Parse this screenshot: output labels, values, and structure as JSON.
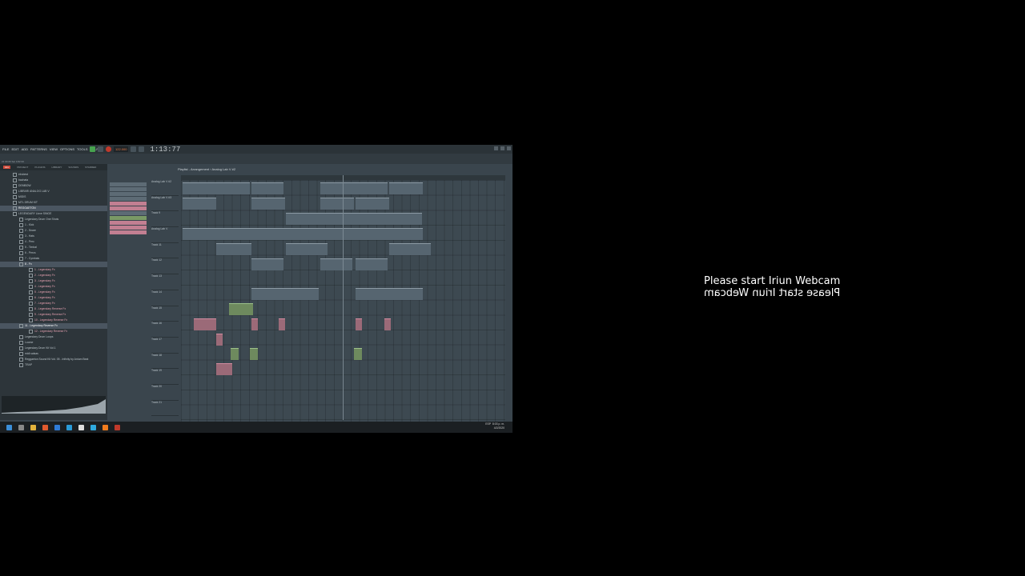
{
  "menu": [
    "FILE",
    "EDIT",
    "ADD",
    "PATTERNS",
    "VIEW",
    "OPTIONS",
    "TOOLS",
    "HELP"
  ],
  "transport": {
    "tempo": "122.000",
    "clock": "1:13:77"
  },
  "hint_text": "21 09 06 Set 0 82 00",
  "browser": {
    "tabs": [
      "ALL",
      "PROJECT",
      "PLUGINS",
      "LIBRARY",
      "SOUNDS",
      "STARRED"
    ],
    "items": [
      {
        "label": "elrobest",
        "cls": ""
      },
      {
        "label": "bachata",
        "cls": ""
      },
      {
        "label": "DEMBOW",
        "cls": ""
      },
      {
        "label": "LIBRARI ANALOG LAB V",
        "cls": ""
      },
      {
        "label": "MIDIS",
        "cls": ""
      },
      {
        "label": "MTL DRUM KIT",
        "cls": ""
      },
      {
        "label": "REGGAETON",
        "cls": "sel"
      },
      {
        "label": "LEGENDARY Llove SINGE",
        "cls": ""
      },
      {
        "label": "Legendary Drum One Shots",
        "cls": ""
      },
      {
        "label": "1 - Kick",
        "cls": ""
      },
      {
        "label": "2 - Snare",
        "cls": ""
      },
      {
        "label": "3 - Hats",
        "cls": ""
      },
      {
        "label": "4 - Perc",
        "cls": ""
      },
      {
        "label": "5 - Timbal",
        "cls": ""
      },
      {
        "label": "6 - Percs",
        "cls": ""
      },
      {
        "label": "7 - Cymbals",
        "cls": ""
      },
      {
        "label": "8 - Fx",
        "cls": "sel"
      },
      {
        "label": "1 - Legendary Fx",
        "cls": "pink"
      },
      {
        "label": "2 - Legendary Fx",
        "cls": "pink"
      },
      {
        "label": "3 - Legendary Fx",
        "cls": "pink"
      },
      {
        "label": "4 - Legendary Fx",
        "cls": "pink"
      },
      {
        "label": "5 - Legendary Fx",
        "cls": "pink"
      },
      {
        "label": "6 - Legendary Fx",
        "cls": "pink"
      },
      {
        "label": "7 - Legendary Fx",
        "cls": "pink"
      },
      {
        "label": "8 - Legendary Reverse Fx",
        "cls": "pink"
      },
      {
        "label": "9 - Legendary Reverse Fx",
        "cls": "pink"
      },
      {
        "label": "10 - Legendary Reverse Fx",
        "cls": "pink"
      },
      {
        "label": "11 - Legendary Reverse Fx",
        "cls": "sel"
      },
      {
        "label": "12 - Legendary Reverse Fx",
        "cls": "pink"
      },
      {
        "label": "Legendary Drum Loops",
        "cls": ""
      },
      {
        "label": "Loome",
        "cls": ""
      },
      {
        "label": "Legendary Drum Kit Vol.1",
        "cls": ""
      },
      {
        "label": "midi salsas",
        "cls": ""
      },
      {
        "label": "Reggaeton Sound Kit Vol. 05 - Infinity by Antum Beat",
        "cls": ""
      },
      {
        "label": "TRAP",
        "cls": ""
      }
    ]
  },
  "playlist": {
    "title": "Playlist - Arrangement › Analog Lab V #2",
    "tracks": [
      "Analog Lab V #2",
      "Analog Lab V #3",
      "Track 9",
      "Analog Lab V",
      "Track 11",
      "Track 12",
      "Track 13",
      "Track 14",
      "Track 15",
      "Track 16",
      "Track 17",
      "Track 18",
      "Track 19",
      "Track 20",
      "Track 21"
    ]
  },
  "tray": {
    "lang": "ESP",
    "time": "8:03 p. m.",
    "date": "4/2/2020"
  },
  "webcam": {
    "line1": "Please start Iriun Webcam",
    "line2": "Please start Iriun Webcam"
  }
}
